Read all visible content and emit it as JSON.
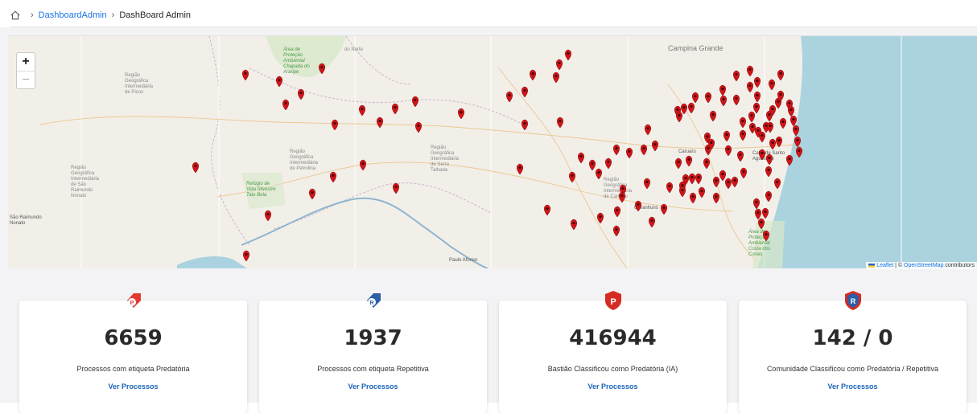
{
  "breadcrumb": {
    "home_icon": "home-icon",
    "link": "DashboardAdmin",
    "current": "DashBoard Admin"
  },
  "map": {
    "zoom_in": "+",
    "zoom_out": "−",
    "attribution": {
      "leaflet": "Leaflet",
      "sep": " | © ",
      "osm": "OpenStreetMap",
      "rest": " contributors"
    },
    "labels": [
      "Campina Grande",
      "do Norte",
      "Área de Proteção Ambiental Chapada do Araripe",
      "Região Geográfica Intermediária de Picos",
      "Região Geográfica Intermediária de Petrolina",
      "Região Geográfica Intermediária de São Raimundo Nonato",
      "Refúgio de Vida Silvestre Tatu Bola",
      "São Raimundo Nonato",
      "Região Geográfica Intermediária de Serra Talhada",
      "Região Geográfica Intermediária de Caruaru",
      "Garanhuns",
      "Paulo Afonso",
      "Área de Proteção Ambiental Costa dos Corais",
      "Caruaru",
      "Cabo de Santo Agostinho"
    ],
    "pin_color": "#d01418"
  },
  "cards": [
    {
      "icon": "predatory-tag-icon",
      "value": "6659",
      "label": "Processos com etiqueta Predatória",
      "link": "Ver Processos"
    },
    {
      "icon": "repetitive-tag-icon",
      "value": "1937",
      "label": "Processos com etiqueta Repetitiva",
      "link": "Ver Processos"
    },
    {
      "icon": "predatory-shield-icon",
      "value": "416944",
      "label": "Bastião Classificou como Predatória (IA)",
      "link": "Ver Processos"
    },
    {
      "icon": "repetitive-shield-icon",
      "value": "142 / 0",
      "label": "Comunidade Classificou como Predatória / Repetitiva",
      "link": "Ver Processos"
    }
  ]
}
